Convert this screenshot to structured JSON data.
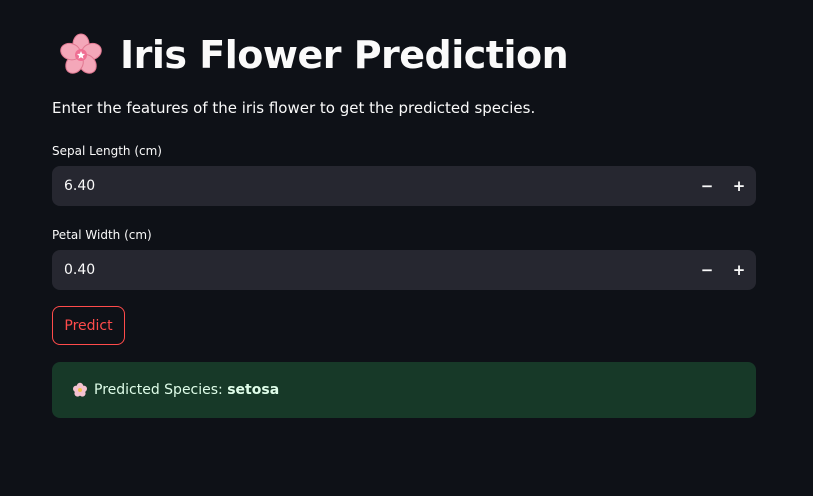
{
  "header": {
    "icon": "cherry-blossom-icon",
    "title": "Iris Flower Prediction"
  },
  "intro": "Enter the features of the iris flower to get the predicted species.",
  "inputs": [
    {
      "label": "Sepal Length (cm)",
      "value": "6.40",
      "decrement": "−",
      "increment": "+"
    },
    {
      "label": "Petal Width (cm)",
      "value": "0.40",
      "decrement": "−",
      "increment": "+"
    }
  ],
  "predict_button": {
    "label": "Predict"
  },
  "result": {
    "icon": "flower-icon",
    "prefix": "Predicted Species: ",
    "species": "setosa"
  },
  "colors": {
    "background": "#0e1117",
    "input_bg": "#262730",
    "accent": "#ff4b4b",
    "success_bg": "#173928",
    "success_text": "#dffde9"
  }
}
